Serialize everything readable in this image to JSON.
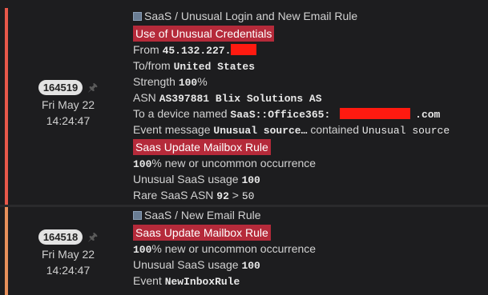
{
  "events": [
    {
      "id": "164519",
      "date": "Fri May 22",
      "time": "14:24:47",
      "stripe_color": "#e8584a",
      "title": "SaaS / Unusual Login and New Email Rule",
      "tag1": "Use of Unusual Credentials",
      "from_label": "From",
      "from_value": "45.132.227.",
      "tofrom_label": "To/from",
      "tofrom_value": "United States",
      "strength_label": "Strength",
      "strength_value": "100",
      "strength_unit": "%",
      "asn_label": "ASN",
      "asn_value": "AS397881 Blix Solutions AS",
      "device_label": "To a device named",
      "device_value": "SaaS::Office365:",
      "device_suffix": ".com",
      "evmsg_label": "Event message",
      "evmsg_value1": "Unusual source…",
      "evmsg_mid": "contained",
      "evmsg_value2": "Unusual source",
      "tag2": "Saas Update Mailbox Rule",
      "pct_value": "100",
      "pct_text": "% new or uncommon occurrence",
      "usage_label": "Unusual SaaS usage",
      "usage_value": "100",
      "rare_label": "Rare SaaS ASN",
      "rare_value": "92",
      "rare_op": ">",
      "rare_threshold": "50"
    },
    {
      "id": "164518",
      "date": "Fri May 22",
      "time": "14:24:47",
      "stripe_color": "#e8905a",
      "title": "SaaS / New Email Rule",
      "tag1": "Saas Update Mailbox Rule",
      "pct_value": "100",
      "pct_text": "% new or uncommon occurrence",
      "usage_label": "Unusual SaaS usage",
      "usage_value": "100",
      "event_label": "Event",
      "event_value": "NewInboxRule"
    }
  ],
  "colors": {
    "tag_bg": "#b52a3a",
    "redaction": "#ff1a10"
  },
  "icons": {
    "pin": "pin-icon",
    "title": "image-icon"
  }
}
